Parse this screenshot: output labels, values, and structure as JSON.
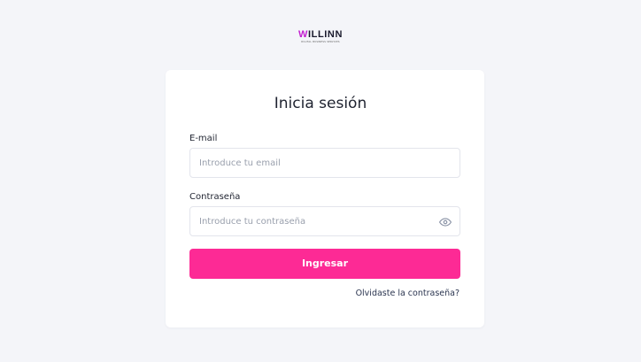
{
  "brand": {
    "logo_initial": "W",
    "logo_rest": "ILLINN",
    "tagline": "DIGITAL BUSINESS SERVICES",
    "accent_color": "#c31ed0"
  },
  "login": {
    "title": "Inicia sesión",
    "email_label": "E-mail",
    "email_placeholder": "Introduce tu email",
    "email_value": "",
    "password_label": "Contraseña",
    "password_placeholder": "Introduce tu contraseña",
    "password_value": "",
    "password_toggle_icon": "eye-icon",
    "submit_label": "Ingresar",
    "forgot_link": "Olvidaste la contraseña?"
  },
  "colors": {
    "background": "#f4f5f9",
    "card": "#ffffff",
    "primary_button": "#fd2a95",
    "link": "#2b3550"
  }
}
